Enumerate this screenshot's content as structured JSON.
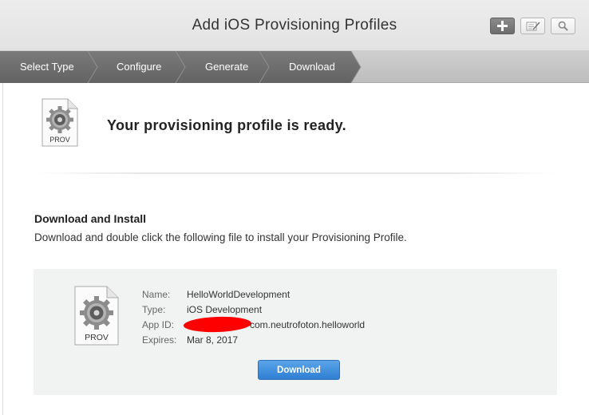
{
  "header": {
    "title": "Add iOS Provisioning Profiles",
    "buttons": {
      "add_icon": "plus-icon",
      "edit_icon": "edit-icon",
      "search_icon": "search-icon"
    }
  },
  "steps": [
    {
      "label": "Select Type"
    },
    {
      "label": "Configure"
    },
    {
      "label": "Generate"
    },
    {
      "label": "Download",
      "active": true
    }
  ],
  "ready": {
    "icon_label": "PROV",
    "title": "Your provisioning profile is ready."
  },
  "download_section": {
    "heading": "Download and Install",
    "description": "Download and double click the following file to install your Provisioning Profile."
  },
  "profile": {
    "icon_label": "PROV",
    "name_label": "Name:",
    "name": "HelloWorldDevelopment",
    "type_label": "Type:",
    "type": "iOS Development",
    "app_id_label": "App ID:",
    "app_id": "com.neutrofoton.helloworld",
    "expires_label": "Expires:",
    "expires": "Mar 8, 2017"
  },
  "download_button": {
    "label": "Download"
  },
  "colors": {
    "accent": "#2f7fd3",
    "active_step": "#6b6b6b",
    "redaction": "#ff0000"
  }
}
